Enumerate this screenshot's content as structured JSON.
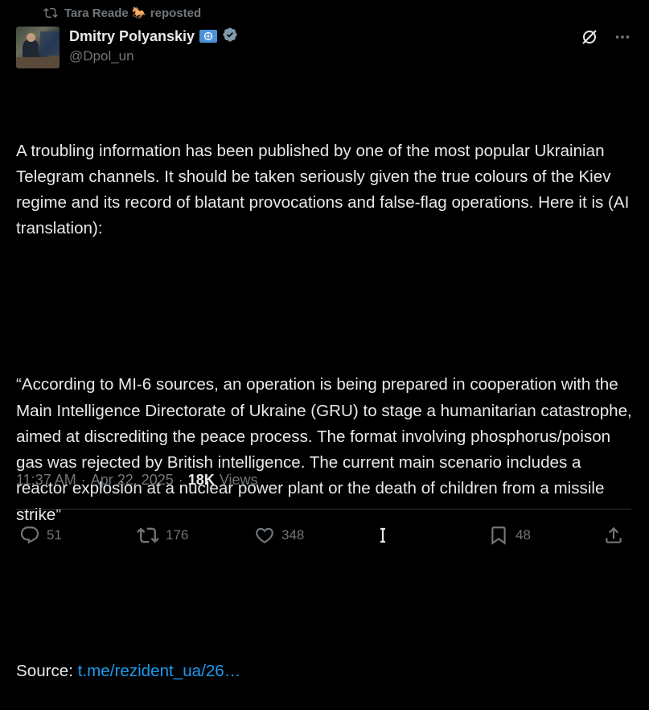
{
  "repost": {
    "text": "Tara Reade 🐎 reposted",
    "icon": "repost-icon"
  },
  "author": {
    "name": "Dmitry Polyanskiy",
    "handle": "@Dpol_un",
    "badges": [
      "un-flag-badge",
      "verified-badge"
    ]
  },
  "post": {
    "paragraph_1": "A troubling information has been published by one of the most popular Ukrainian Telegram channels. It should be taken seriously given the true colours of the Kiev regime and its record of blatant provocations and false-flag operations. Here it is (AI translation):",
    "paragraph_2": "“According to MI-6 sources, an operation is being prepared in cooperation with the Main Intelligence Directorate of Ukraine (GRU) to stage a humanitarian catastrophe, aimed at discrediting the peace process. The format involving phosphorus/poison gas was rejected by British intelligence. The current main scenario includes a reactor explosion at a nuclear power plant or the death of children from a missile strike”",
    "source_label": "Source: ",
    "source_link": "t.me/rezident_ua/26…"
  },
  "meta": {
    "time": "11:37 AM",
    "separator": "·",
    "date": "Apr 22, 2025",
    "views_count": "18K",
    "views_label": "Views"
  },
  "actions": {
    "replies": "51",
    "reposts": "176",
    "likes": "348",
    "bookmarks": "48"
  },
  "colors": {
    "background": "#000000",
    "text": "#e7e9ea",
    "muted": "#71767b",
    "link": "#1d9bf0",
    "verified": "#829aab"
  }
}
